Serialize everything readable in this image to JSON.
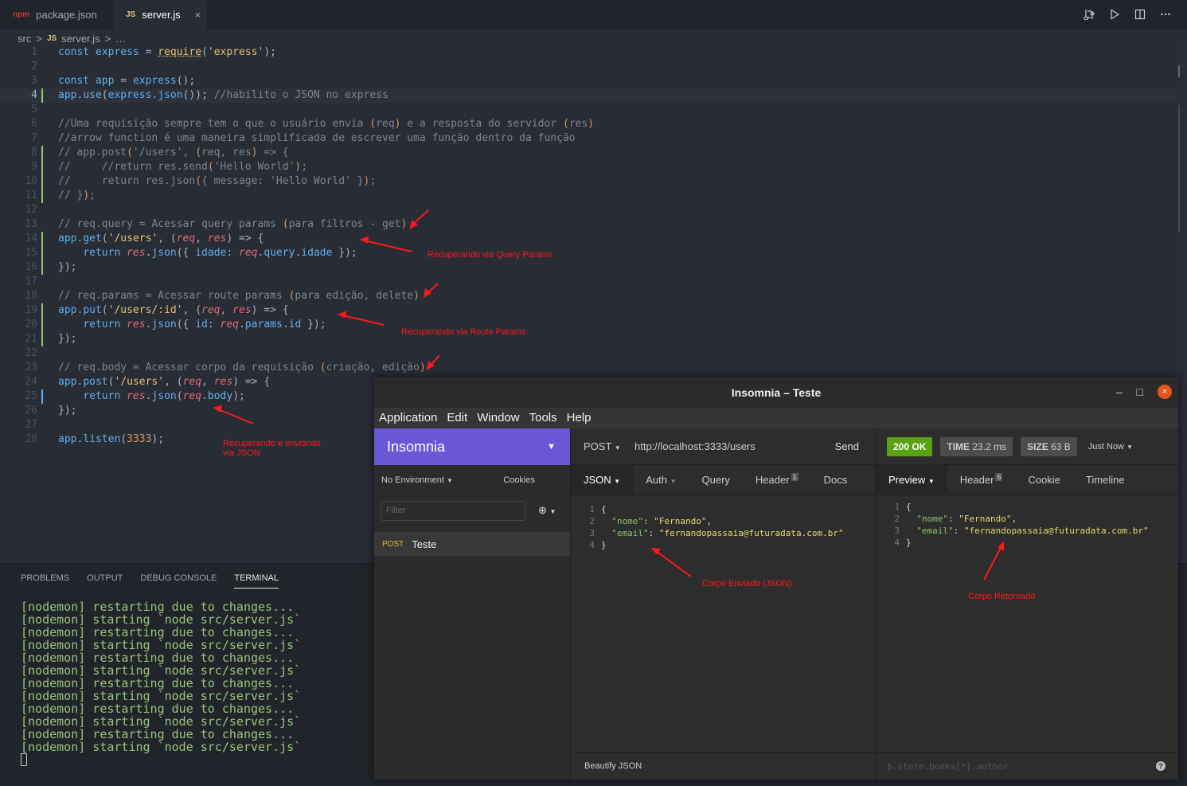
{
  "vscode": {
    "tabs": [
      {
        "icon": "npm",
        "label": "package.json"
      },
      {
        "icon": "JS",
        "label": "server.js",
        "close": "×"
      }
    ],
    "breadcrumb": {
      "folder": "src",
      "sep": ">",
      "file_icon": "JS",
      "file": "server.js",
      "more": "…"
    },
    "code_lines": [
      "const express = require('express');",
      "",
      "const app = express();",
      "app.use(express.json()); //habilito o JSON no express",
      "",
      "//Uma requisição sempre tem o que o usuário envia (req) e a resposta do servidor (res)",
      "//arrow function é uma maneira simplificada de escrever uma função dentro da função",
      "// app.post('/users', (req, res) => {",
      "//     //return res.send('Hello World');",
      "//     return res.json({ message: 'Hello World' });",
      "// });",
      "",
      "// req.query = Acessar query params (para filtros - get)",
      "app.get('/users', (req, res) => {",
      "    return res.json({ idade: req.query.idade });",
      "});",
      "",
      "// req.params = Acessar route params (para edição, delete)",
      "app.put('/users/:id', (req, res) => {",
      "    return res.json({ id: req.params.id });",
      "});",
      "",
      "// req.body = Acessar corpo da requisição (criação, edição)",
      "app.post('/users', (req, res) => {",
      "    return res.json(req.body);",
      "});",
      "",
      "app.listen(3333);"
    ],
    "annotations": {
      "query": "Recuperando via Query Params",
      "route": "Recuperando via Route Params",
      "body_1": "Recuperando e enviando",
      "body_2": "via JSON"
    },
    "panel": {
      "tabs": [
        "PROBLEMS",
        "OUTPUT",
        "DEBUG CONSOLE",
        "TERMINAL"
      ],
      "terminal_lines": [
        "[nodemon] restarting due to changes...",
        "[nodemon] starting `node src/server.js`",
        "[nodemon] restarting due to changes...",
        "[nodemon] starting `node src/server.js`",
        "[nodemon] restarting due to changes...",
        "[nodemon] starting `node src/server.js`",
        "[nodemon] restarting due to changes...",
        "[nodemon] starting `node src/server.js`",
        "[nodemon] restarting due to changes...",
        "[nodemon] starting `node src/server.js`",
        "[nodemon] restarting due to changes...",
        "[nodemon] starting `node src/server.js`"
      ]
    }
  },
  "insomnia": {
    "title": "Insomnia – Teste",
    "window_controls": {
      "minimize": "–",
      "maximize": "□",
      "close": "×"
    },
    "menu": [
      "Application",
      "Edit",
      "Window",
      "Tools",
      "Help"
    ],
    "workspace": "Insomnia",
    "environment": "No Environment",
    "cookies": "Cookies",
    "filter_placeholder": "Filter",
    "request": {
      "method": "POST",
      "name": "Teste"
    },
    "url_bar": {
      "method": "POST",
      "url": "http://localhost:3333/users",
      "send": "Send"
    },
    "request_tabs": [
      {
        "label": "JSON",
        "active": true
      },
      {
        "label": "Auth"
      },
      {
        "label": "Query"
      },
      {
        "label": "Header",
        "badge": "1"
      },
      {
        "label": "Docs"
      }
    ],
    "request_body": [
      {
        "n": "1",
        "text": "{"
      },
      {
        "n": "2",
        "key": "\"nome\"",
        "value": "\"Fernando\"",
        "tail": ","
      },
      {
        "n": "3",
        "key": "\"email\"",
        "value": "\"fernandopassaia@futuradata.com.br\""
      },
      {
        "n": "4",
        "text": "}"
      }
    ],
    "beautify": "Beautify JSON",
    "response_status": {
      "code": "200 OK",
      "time_label": "TIME",
      "time": "23.2 ms",
      "size_label": "SIZE",
      "size": "63 B",
      "when": "Just Now"
    },
    "response_tabs": [
      {
        "label": "Preview",
        "active": true
      },
      {
        "label": "Header",
        "badge": "6"
      },
      {
        "label": "Cookie"
      },
      {
        "label": "Timeline"
      }
    ],
    "response_body": [
      {
        "n": "1",
        "text": "{"
      },
      {
        "n": "2",
        "key": "\"nome\"",
        "value": "\"Fernando\"",
        "tail": ","
      },
      {
        "n": "3",
        "key": "\"email\"",
        "value": "\"fernandopassaia@futuradata.com.br\""
      },
      {
        "n": "4",
        "text": "}"
      }
    ],
    "response_filter_placeholder": "$.store.books[*].author",
    "help": "?",
    "annotations": {
      "sent": "Corpo Enviado (JSON)",
      "returned": "Corpo Retornado"
    }
  },
  "colors": {
    "accent_purple": "#6a57d5",
    "ok_green": "#59a212",
    "annotation_red": "#ff1a1a"
  }
}
